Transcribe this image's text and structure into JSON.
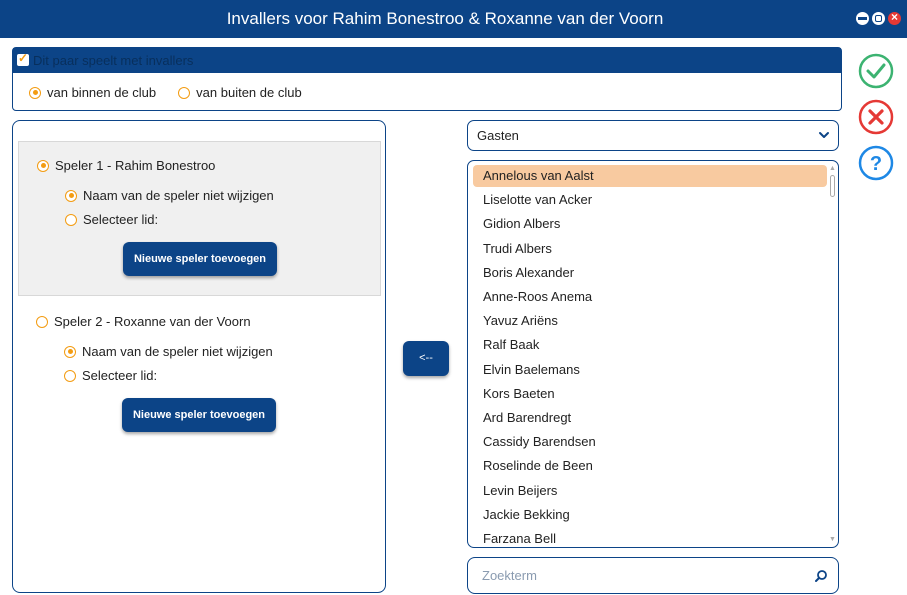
{
  "window": {
    "title": "Invallers voor Rahim Bonestroo & Roxanne van der Voorn",
    "accent": "#0c4487",
    "orange": "#f39c12"
  },
  "invallers": {
    "checkbox_label": "Dit paar speelt met invallers",
    "checked": true,
    "options": [
      "van binnen de club",
      "van buiten de club"
    ],
    "selected_option": "van binnen de club"
  },
  "players": [
    {
      "label": "Speler 1 - Rahim Bonestroo",
      "selected": true,
      "opt_keep": "Naam van de speler niet wijzigen",
      "opt_select": "Selecteer lid:",
      "add_button": "Nieuwe speler toevoegen"
    },
    {
      "label": "Speler 2 - Roxanne van der Voorn",
      "selected": false,
      "opt_keep": "Naam van de speler niet wijzigen",
      "opt_select": "Selecteer lid:",
      "add_button": "Nieuwe speler toevoegen"
    }
  ],
  "transfer_button": "<--",
  "dropdown": {
    "value": "Gasten",
    "icon": "chevron-down-icon"
  },
  "members": [
    "Annelous van  Aalst",
    "Liselotte van Acker",
    "Gidion Albers",
    "Trudi Albers",
    "Boris Alexander",
    "Anne-Roos Anema",
    "Yavuz Ariëns",
    "Ralf Baak",
    "Elvin Baelemans",
    "Kors Baeten",
    "Ard Barendregt",
    "Cassidy Barendsen",
    "Roselinde de Been",
    "Levin Beijers",
    "Jackie Bekking",
    "Farzana Bell"
  ],
  "selected_member": "Annelous van  Aalst",
  "search": {
    "placeholder": "Zoekterm",
    "icon": "search-icon"
  },
  "side_buttons": [
    {
      "name": "confirm",
      "icon": "check-icon",
      "color": "#3cb371"
    },
    {
      "name": "cancel",
      "icon": "close-icon",
      "color": "#e53935"
    },
    {
      "name": "help",
      "icon": "question-icon",
      "color": "#1e88e5"
    }
  ]
}
